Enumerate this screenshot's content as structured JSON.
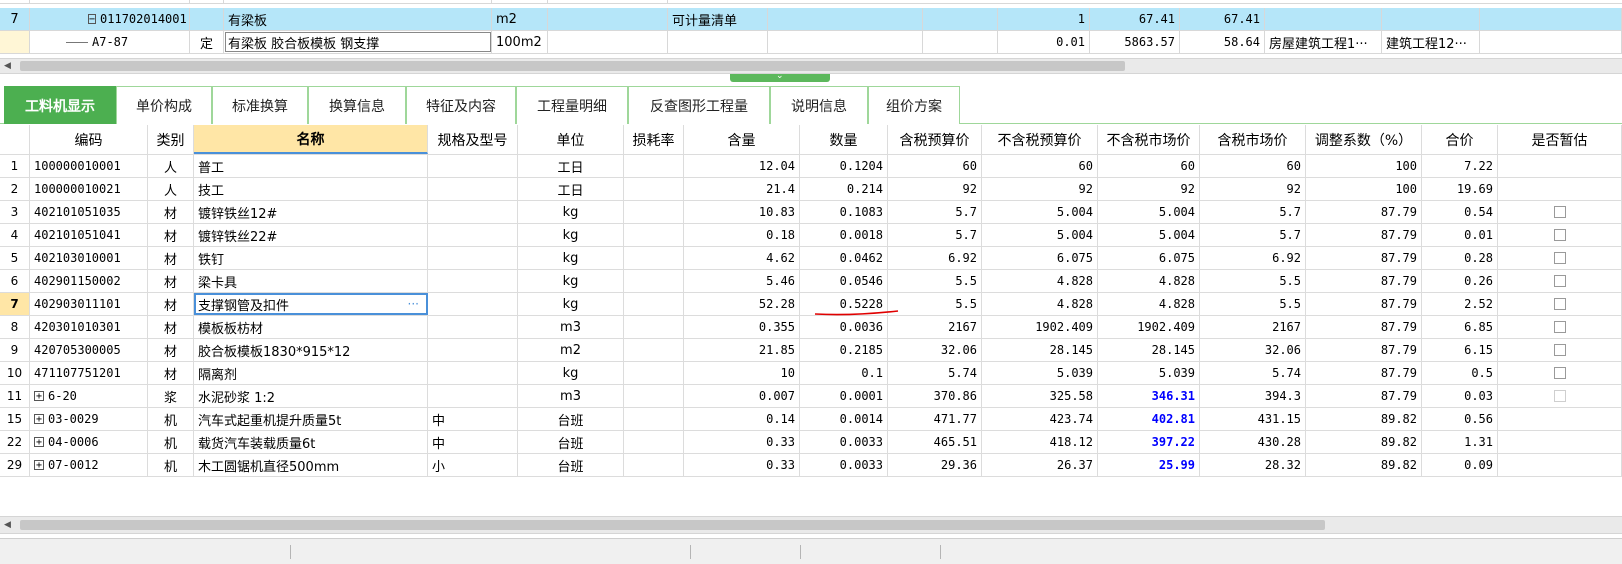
{
  "top_table": {
    "rows": [
      {
        "no": "7",
        "code": "011702014001",
        "type": "",
        "name": "有梁板",
        "unit": "m2",
        "remark": "可计量清单",
        "qty": "1",
        "price": "67.41",
        "total": "67.41",
        "special": "",
        "category": "",
        "expand": "−"
      },
      {
        "no": "",
        "code": "A7-87",
        "type": "定",
        "name": "有梁板 胶合板模板 钢支撑",
        "unit": "100m2",
        "remark": "",
        "qty": "0.01",
        "price": "5863.57",
        "total": "58.64",
        "special": "房屋建筑工程1···",
        "category": "建筑工程12···",
        "expand": ""
      }
    ]
  },
  "tabs": [
    {
      "label": "工料机显示",
      "active": true
    },
    {
      "label": "单价构成",
      "active": false
    },
    {
      "label": "标准换算",
      "active": false
    },
    {
      "label": "换算信息",
      "active": false
    },
    {
      "label": "特征及内容",
      "active": false
    },
    {
      "label": "工程量明细",
      "active": false
    },
    {
      "label": "反查图形工程量",
      "active": false
    },
    {
      "label": "说明信息",
      "active": false
    },
    {
      "label": "组价方案",
      "active": false
    }
  ],
  "detail": {
    "headers": [
      "编码",
      "类别",
      "名称",
      "规格及型号",
      "单位",
      "损耗率",
      "含量",
      "数量",
      "含税预算价",
      "不含税预算价",
      "不含税市场价",
      "含税市场价",
      "调整系数（%）",
      "合价",
      "是否暂估"
    ],
    "rows": [
      {
        "n": "1",
        "code": "100000010001",
        "cat": "人",
        "name": "普工",
        "spec": "",
        "unit": "工日",
        "loss": "",
        "content": "12.04",
        "qty": "0.1204",
        "tp": "60",
        "ntp": "60",
        "nmp": "60",
        "tmp": "60",
        "adj": "100",
        "sum": "7.22",
        "cb": "none",
        "exp": false,
        "blue": false
      },
      {
        "n": "2",
        "code": "100000010021",
        "cat": "人",
        "name": "技工",
        "spec": "",
        "unit": "工日",
        "loss": "",
        "content": "21.4",
        "qty": "0.214",
        "tp": "92",
        "ntp": "92",
        "nmp": "92",
        "tmp": "92",
        "adj": "100",
        "sum": "19.69",
        "cb": "none",
        "exp": false,
        "blue": false
      },
      {
        "n": "3",
        "code": "402101051035",
        "cat": "材",
        "name": "镀锌铁丝12#",
        "spec": "",
        "unit": "kg",
        "loss": "",
        "content": "10.83",
        "qty": "0.1083",
        "tp": "5.7",
        "ntp": "5.004",
        "nmp": "5.004",
        "tmp": "5.7",
        "adj": "87.79",
        "sum": "0.54",
        "cb": "box",
        "exp": false,
        "blue": false
      },
      {
        "n": "4",
        "code": "402101051041",
        "cat": "材",
        "name": "镀锌铁丝22#",
        "spec": "",
        "unit": "kg",
        "loss": "",
        "content": "0.18",
        "qty": "0.0018",
        "tp": "5.7",
        "ntp": "5.004",
        "nmp": "5.004",
        "tmp": "5.7",
        "adj": "87.79",
        "sum": "0.01",
        "cb": "box",
        "exp": false,
        "blue": false
      },
      {
        "n": "5",
        "code": "402103010001",
        "cat": "材",
        "name": "铁钉",
        "spec": "",
        "unit": "kg",
        "loss": "",
        "content": "4.62",
        "qty": "0.0462",
        "tp": "6.92",
        "ntp": "6.075",
        "nmp": "6.075",
        "tmp": "6.92",
        "adj": "87.79",
        "sum": "0.28",
        "cb": "box",
        "exp": false,
        "blue": false
      },
      {
        "n": "6",
        "code": "402901150002",
        "cat": "材",
        "name": "梁卡具",
        "spec": "",
        "unit": "kg",
        "loss": "",
        "content": "5.46",
        "qty": "0.0546",
        "tp": "5.5",
        "ntp": "4.828",
        "nmp": "4.828",
        "tmp": "5.5",
        "adj": "87.79",
        "sum": "0.26",
        "cb": "box",
        "exp": false,
        "blue": false
      },
      {
        "n": "7",
        "code": "402903011101",
        "cat": "材",
        "name": "支撑钢管及扣件",
        "spec": "",
        "unit": "kg",
        "loss": "",
        "content": "52.28",
        "qty": "0.5228",
        "tp": "5.5",
        "ntp": "4.828",
        "nmp": "4.828",
        "tmp": "5.5",
        "adj": "87.79",
        "sum": "2.52",
        "cb": "box",
        "exp": false,
        "blue": false,
        "cur": true
      },
      {
        "n": "8",
        "code": "420301010301",
        "cat": "材",
        "name": "模板板枋材",
        "spec": "",
        "unit": "m3",
        "loss": "",
        "content": "0.355",
        "qty": "0.0036",
        "tp": "2167",
        "ntp": "1902.409",
        "nmp": "1902.409",
        "tmp": "2167",
        "adj": "87.79",
        "sum": "6.85",
        "cb": "box",
        "exp": false,
        "blue": false
      },
      {
        "n": "9",
        "code": "420705300005",
        "cat": "材",
        "name": "胶合板模板1830*915*12",
        "spec": "",
        "unit": "m2",
        "loss": "",
        "content": "21.85",
        "qty": "0.2185",
        "tp": "32.06",
        "ntp": "28.145",
        "nmp": "28.145",
        "tmp": "32.06",
        "adj": "87.79",
        "sum": "6.15",
        "cb": "box",
        "exp": false,
        "blue": false
      },
      {
        "n": "10",
        "code": "471107751201",
        "cat": "材",
        "name": "隔离剂",
        "spec": "",
        "unit": "kg",
        "loss": "",
        "content": "10",
        "qty": "0.1",
        "tp": "5.74",
        "ntp": "5.039",
        "nmp": "5.039",
        "tmp": "5.74",
        "adj": "87.79",
        "sum": "0.5",
        "cb": "box",
        "exp": false,
        "blue": false
      },
      {
        "n": "11",
        "code": "6-20",
        "cat": "浆",
        "name": "水泥砂浆 1:2",
        "spec": "",
        "unit": "m3",
        "loss": "",
        "content": "0.007",
        "qty": "0.0001",
        "tp": "370.86",
        "ntp": "325.58",
        "nmp": "346.31",
        "tmp": "394.3",
        "adj": "87.79",
        "sum": "0.03",
        "cb": "dis",
        "exp": true,
        "blue": true
      },
      {
        "n": "15",
        "code": "03-0029",
        "cat": "机",
        "name": "汽车式起重机提升质量5t",
        "spec": "中",
        "unit": "台班",
        "loss": "",
        "content": "0.14",
        "qty": "0.0014",
        "tp": "471.77",
        "ntp": "423.74",
        "nmp": "402.81",
        "tmp": "431.15",
        "adj": "89.82",
        "sum": "0.56",
        "cb": "none",
        "exp": true,
        "blue": true
      },
      {
        "n": "22",
        "code": "04-0006",
        "cat": "机",
        "name": "载货汽车装载质量6t",
        "spec": "中",
        "unit": "台班",
        "loss": "",
        "content": "0.33",
        "qty": "0.0033",
        "tp": "465.51",
        "ntp": "418.12",
        "nmp": "397.22",
        "tmp": "430.28",
        "adj": "89.82",
        "sum": "1.31",
        "cb": "none",
        "exp": true,
        "blue": true
      },
      {
        "n": "29",
        "code": "07-0012",
        "cat": "机",
        "name": "木工圆锯机直径500mm",
        "spec": "小",
        "unit": "台班",
        "loss": "",
        "content": "0.33",
        "qty": "0.0033",
        "tp": "29.36",
        "ntp": "26.37",
        "nmp": "25.99",
        "tmp": "28.32",
        "adj": "89.82",
        "sum": "0.09",
        "cb": "none",
        "exp": true,
        "blue": true
      }
    ]
  },
  "colors": {
    "tab_active": "#4caf50",
    "selected_row": "#b5e6f9",
    "header_highlight": "#ffe6a6",
    "market_price_blue": "#0000ff",
    "annotation_red": "#e00000"
  }
}
